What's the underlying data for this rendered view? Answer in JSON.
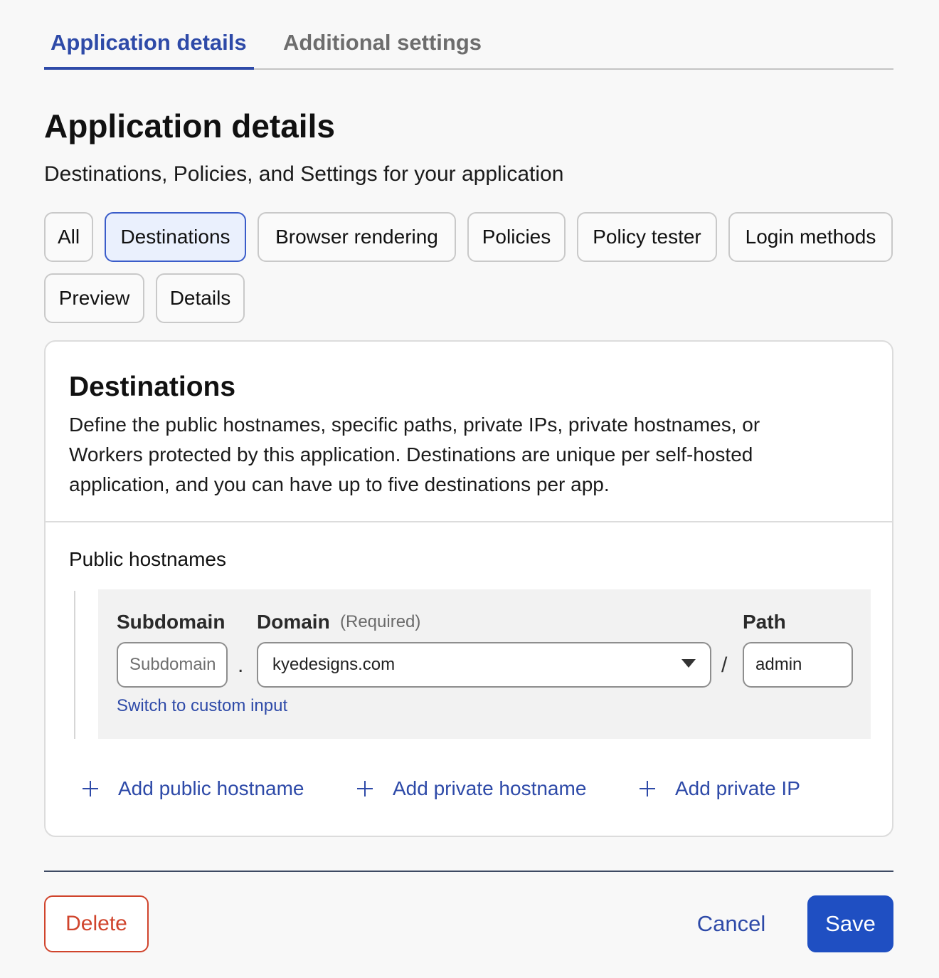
{
  "tabs": {
    "active": "Application details",
    "inactive": "Additional settings"
  },
  "header": {
    "title": "Application details",
    "subtitle": "Destinations, Policies, and Settings for your application"
  },
  "filters": [
    "All",
    "Destinations",
    "Browser rendering",
    "Policies",
    "Policy tester",
    "Login methods",
    "Preview",
    "Details"
  ],
  "filters_selected": "Destinations",
  "destinations": {
    "title": "Destinations",
    "description": "Define the public hostnames, specific paths, private IPs, private hostnames, or Workers protected by this application. Destinations are unique per self-hosted application, and you can have up to five destinations per app.",
    "section_label": "Public hostnames",
    "subdomain_label": "Subdomain",
    "subdomain_placeholder": "Subdomain",
    "dot": ".",
    "domain_label": "Domain",
    "domain_required": "(Required)",
    "domain_value": "kyedesigns.com",
    "slash": "/",
    "path_label": "Path",
    "path_value": "admin",
    "switch_link": "Switch to custom input",
    "add_public": "Add public hostname",
    "add_private_hostname": "Add private hostname",
    "add_private_ip": "Add private IP"
  },
  "footer": {
    "delete": "Delete",
    "cancel": "Cancel",
    "save": "Save"
  },
  "colors": {
    "accent": "#2e4aa8",
    "danger": "#d0442c",
    "primary_button": "#1f4fc2",
    "selected_chip_bg": "#eaf0fd"
  }
}
